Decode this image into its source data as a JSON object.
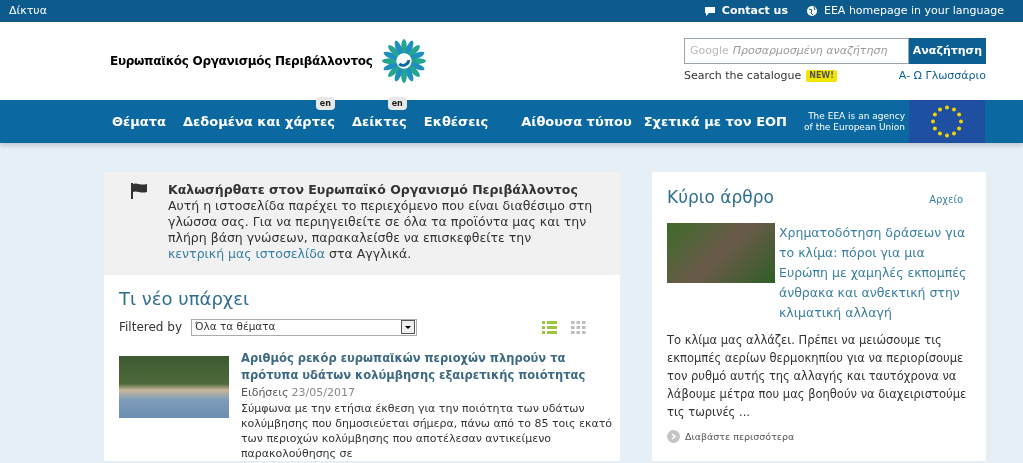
{
  "top_bar": {
    "left_link": "Δίκτυα",
    "links": [
      {
        "kind": "chat",
        "label": "Contact us"
      },
      {
        "kind": "globe",
        "label": "EEA homepage in your language"
      }
    ]
  },
  "header": {
    "logo_text": "Ευρωπαϊκός Οργανισμός Περιβάλλοντος",
    "search": {
      "brand": "Google",
      "placeholder": "Προσαρμοσμένη αναζήτηση",
      "button": "Αναζήτηση"
    },
    "catalogue_link": "Search the catalogue",
    "catalogue_badge": "NEW!",
    "glossary_link": "Α- Ω Γλωσσάριο"
  },
  "nav": {
    "items": [
      {
        "label": "Θέματα"
      },
      {
        "label": "Δεδομένα και χάρτες",
        "badge": "en"
      },
      {
        "label": "Δείκτες",
        "badge": "en"
      },
      {
        "label": "Εκθέσεις"
      }
    ],
    "right_items": [
      {
        "label": "Αίθουσα τύπου"
      },
      {
        "label": "Σχετικά με τον ΕΟΠ"
      }
    ],
    "eu_text": "The EEA is an agency of the European Union"
  },
  "welcome": {
    "title": "Καλωσήρθατε στον Ευρωπαϊκό Οργανισμό Περιβάλλοντος",
    "body": "Αυτή η ιστοσελίδα παρέχει το περιεχόμενο που είναι διαθέσιμο στη γλώσσα σας. Για να περιηγειθείτε σε όλα τα προϊόντα μας και την πλήρη βάση γνώσεων, παρακαλείσθε να επισκεφθείτε την ",
    "link": "κεντρική μας ιστοσελίδα",
    "body_end": " στα Αγγλικά."
  },
  "whats_new": {
    "title": "Τι νέο υπάρχει",
    "filter_label": "Filtered by",
    "filter_value": "Όλα τα θέματα",
    "views": [
      {
        "kind": "list",
        "selected": true
      },
      {
        "kind": "grid",
        "selected": false
      }
    ],
    "items": [
      {
        "title": "Αριθμός ρεκόρ ευρωπαϊκών περιοχών πληρούν τα πρότυπα υδάτων κολύμβησης εξαιρετικής ποιότητας",
        "category": "Ειδήσεις",
        "date": "23/05/2017",
        "summary": "Σύμφωνα με την ετήσια έκθεση για την ποιότητα των υδάτων κολύμβησης που δημοσιεύεται σήμερα, πάνω από το 85 τοις εκατό των περιοχών κολύμβησης που αποτέλεσαν αντικείμενο παρακολούθησης σε"
      }
    ]
  },
  "featured": {
    "title": "Κύριο άρθρο",
    "archive_link": "Αρχείο",
    "article_title": "Χρηματοδότηση δράσεων για το κλίμα: πόροι για μια Ευρώπη με χαμηλές εκπομπές άνθρακα και ανθεκτική στην κλιματική αλλαγή",
    "summary": "Το κλίμα μας αλλάζει. Πρέπει να μειώσουμε τις εκπομπές αερίων θερμοκηπίου για να περιορίσουμε τον ρυθμό αυτής της αλλαγής και ταυτόχρονα να λάβουμε μέτρα που μας βοηθούν να διαχειριστούμε τις τωρινές ...",
    "read_more": "Διαβάστε περισσότερα"
  }
}
